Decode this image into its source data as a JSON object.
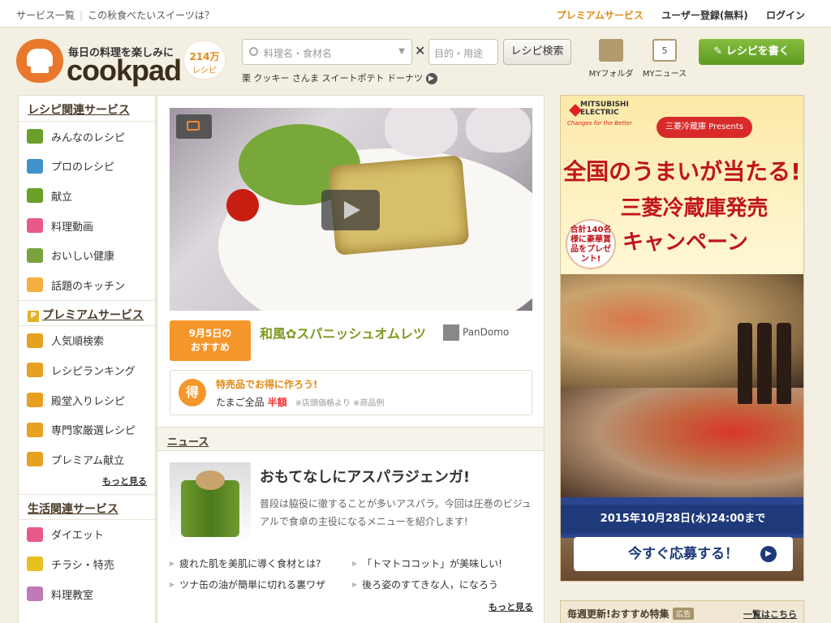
{
  "topbar": {
    "services_link": "サービス一覧",
    "featured_link": "この秋食べたいスイーツは？",
    "premium_link": "プレミアムサービス",
    "register_link": "ユーザー登録(無料)",
    "login_link": "ログイン"
  },
  "header": {
    "tagline": "毎日の料理を楽しみに",
    "logo_text": "cookpad",
    "recipe_count": "214万",
    "recipe_count_label": "レシピ",
    "search": {
      "ingredient_placeholder": "料理名・食材名",
      "purpose_placeholder": "目的・用途",
      "button_label": "レシピ検索",
      "keywords": [
        "栗",
        "クッキー",
        "さんま",
        "スイートポテト",
        "ドーナツ"
      ]
    },
    "my_folder_label": "MYフォルダ",
    "my_news_label": "MYニュース",
    "my_news_day": "5",
    "write_recipe_label": "レシピを書く"
  },
  "sidebar": {
    "recipe_section_title": "レシピ関連サービス",
    "recipe_items": [
      {
        "label": "みんなのレシピ",
        "icon": "fork-knife-icon",
        "color": "#6aa02a"
      },
      {
        "label": "プロのレシピ",
        "icon": "book-icon",
        "color": "#3f93c8"
      },
      {
        "label": "献立",
        "icon": "bento-icon",
        "color": "#6aa02a"
      },
      {
        "label": "料理動画",
        "icon": "video-camera-icon",
        "color": "#e8598a"
      },
      {
        "label": "おいしい健康",
        "icon": "person-icon",
        "color": "#7aa23a"
      },
      {
        "label": "話題のキッチン",
        "icon": "chef-icon",
        "color": "#f5b041"
      }
    ],
    "premium_section_title": "プレミアムサービス",
    "premium_items": [
      {
        "label": "人気順検索",
        "icon": "crown-icon",
        "color": "#e8a020"
      },
      {
        "label": "レシピランキング",
        "icon": "ranking-icon",
        "color": "#e8a020"
      },
      {
        "label": "殿堂入りレシピ",
        "icon": "trophy-icon",
        "color": "#e8a020"
      },
      {
        "label": "専門家厳選レシピ",
        "icon": "expert-icon",
        "color": "#e8a020"
      },
      {
        "label": "プレミアム献立",
        "icon": "star-dish-icon",
        "color": "#e8a020"
      }
    ],
    "more_label": "もっと見る",
    "life_section_title": "生活関連サービス",
    "life_items": [
      {
        "label": "ダイエット",
        "icon": "scale-icon",
        "color": "#e8598a"
      },
      {
        "label": "チラシ・特売",
        "icon": "megaphone-icon",
        "color": "#e8c020"
      },
      {
        "label": "料理教室",
        "icon": "house-icon",
        "color": "#c07ab8"
      }
    ]
  },
  "main": {
    "today_badge_line1": "9月5日の",
    "today_badge_line2": "おすすめ",
    "recipe_title": "和風✿スパニッシュオムレツ",
    "author": "PanDomo",
    "deal_badge": "得",
    "deal_title": "特売品でお得に作ろう!",
    "deal_item": "たまご全品",
    "deal_discount": "半額",
    "deal_note": "※店頭価格より ※商品例",
    "news_header": "ニュース",
    "news_title": "おもてなしにアスパラジェンガ!",
    "news_body": "普段は脇役に徹することが多いアスパラ。今回は圧巻のビジュアルで食卓の主役になるメニューを紹介します!",
    "news_links": [
      "疲れた肌を美肌に導く食材とは?",
      "「トマトココット」が美味しい!",
      "ツナ缶の油が簡単に切れる裏ワザ",
      "後ろ姿のすてきな人，になろう"
    ],
    "news_more": "もっと見る"
  },
  "ad": {
    "brand_line1": "MITSUBISHI",
    "brand_line2": "ELECTRIC",
    "brand_slogan": "Changes for the Better",
    "presents": "三菱冷蔵庫 Presents",
    "headline1": "全国のうまいが当たる!",
    "headline2": "三菱冷蔵庫発売",
    "prize_circle": "合計140名様に豪華賞品をプレゼント!",
    "headline3": "キャンペーン",
    "deadline": "2015年10月28日(水)24:00まで",
    "apply_label": "今すぐ応募する！"
  },
  "weekly": {
    "title": "毎週更新!おすすめ特集",
    "ad_tag": "広告",
    "all_link": "一覧はこちら"
  }
}
